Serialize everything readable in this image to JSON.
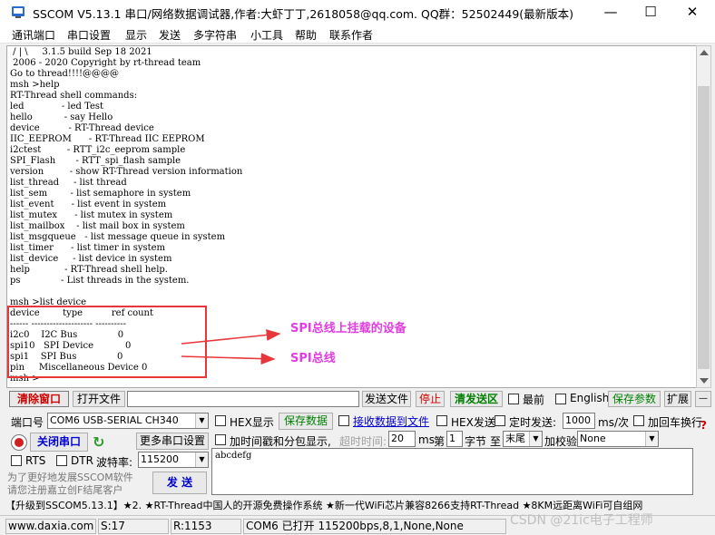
{
  "window": {
    "title": "SSCOM V5.13.1 串口/网络数据调试器,作者:大虾丁丁,2618058@qq.com. QQ群：52502449(最新版本)",
    "minimize": "—",
    "maximize": "☐",
    "close": "✕"
  },
  "menu": [
    "通讯端口",
    "串口设置",
    "显示",
    "发送",
    "多字符串",
    "小工具",
    "帮助",
    "联系作者"
  ],
  "terminal": {
    "lines": [
      " / | \\     3.1.5 build Sep 18 2021",
      " 2006 - 2020 Copyright by rt-thread team",
      "Go to thread!!!!@@@@",
      "msh >help",
      "RT-Thread shell commands:",
      "led             - led Test",
      "hello           - say Hello",
      "device          - RT-Thread device",
      "IIC_EEPROM      - RT-Thread IIC EEPROM",
      "i2ctest         - RTT_i2c_eeprom sample",
      "SPI_Flash       - RTT_spi_flash sample",
      "version         - show RT-Thread version information",
      "list_thread     - list thread",
      "list_sem        - list semaphore in system",
      "list_event      - list event in system",
      "list_mutex      - list mutex in system",
      "list_mailbox    - list mail box in system",
      "list_msgqueue   - list message queue in system",
      "list_timer      - list timer in system",
      "list_device     - list device in system",
      "help            - RT-Thread shell help.",
      "ps              - List threads in the system.",
      "",
      "msh >list device",
      "device        type          ref count",
      "------ -------------------- ----------",
      "i2c0    I2C Bus              0",
      "spi10   SPI Device           0",
      "spi1    SPI Bus              0",
      "pin     Miscellaneous Device 0",
      "msh >"
    ]
  },
  "annotations": {
    "label1": "SPI总线上挂载的设备",
    "label2": "SPI总线",
    "color": "#e03ee0",
    "box_color": "#e8373a"
  },
  "toolbar": {
    "clear_window": "清除窗口",
    "open_file": "打开文件",
    "send_file": "发送文件",
    "stop": "停止",
    "clear_send": "清发送区",
    "last": "最前",
    "english": "English",
    "save_params": "保存参数",
    "expand": "扩展",
    "minus": "—"
  },
  "port": {
    "label": "端口号",
    "value": "COM6 USB-SERIAL CH340",
    "hex_display": "HEX显示",
    "save_data": "保存数据",
    "recv_to_file": "接收数据到文件",
    "hex_send": "HEX发送",
    "timed_send": "定时发送:",
    "interval": "1000",
    "interval_unit": "ms/次",
    "add_crlf": "加回车换行",
    "close_port": "关闭串口",
    "more_settings": "更多串口设置",
    "timestamp": "加时间戳和分包显示,",
    "timeout_label": "超时时间:",
    "timeout": "20",
    "timeout_unit": "ms",
    "byte_label": "第",
    "byte_value": "1",
    "byte_unit": "字节",
    "to_label": "至",
    "to_value": "末尾",
    "checksum_label": "加校验",
    "checksum_value": "None",
    "rts": "RTS",
    "dtr": "DTR",
    "baud_label": "波特率:",
    "baud_value": "115200",
    "promo_line1": "为了更好地发展SSCOM软件",
    "promo_line2": "请您注册嘉立创F结尾客户",
    "send_button": "发 送",
    "send_text": "abcdefg",
    "help_mark": "?"
  },
  "ticker": "【升级到SSCOM5.13.1】★2. ★RT-Thread中国人的开源免费操作系统 ★新一代WiFi芯片兼容8266支持RT-Thread ★8KM远距离WiFi可自组网",
  "status": {
    "website": "www.daxia.com",
    "sent": "S:17",
    "received": "R:1153",
    "port_info": "COM6 已打开  115200bps,8,1,None,None"
  },
  "watermark": "CSDN @21ic电子工程师"
}
